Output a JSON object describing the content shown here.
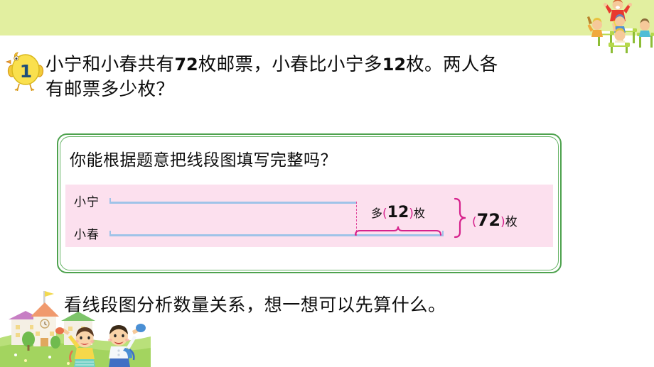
{
  "slide": {
    "band_color": "#e2efa0",
    "accent_green": "#4ea24e",
    "panel_pink": "#fce0ee",
    "segment_blue": "#9fc3e8",
    "annotation_magenta": "#d6228c",
    "badge_number": "1",
    "badge_number_color": "#1f4e79"
  },
  "problem": {
    "line1": "小宁和小春共有",
    "line1_number": "72",
    "line1_cont": "枚邮票，小春比小宁多",
    "line1_number2": "12",
    "line1_end": "枚。两人各",
    "line2": "有邮票多少枚？",
    "full_text": "小宁和小春共有72枚邮票，小春比小宁多12枚。两人各有邮票多少枚？"
  },
  "framed_box": {
    "question": "你能根据题意把线段图填写完整吗？"
  },
  "diagram": {
    "label_top": "小宁",
    "label_bottom": "小春",
    "difference_prefix": "多",
    "difference_open_paren": "(",
    "difference_value": "12",
    "difference_close_paren": ")",
    "difference_unit": "枚",
    "total_open_paren": "(",
    "total_value": "72",
    "total_close_paren": ")",
    "total_unit": "枚"
  },
  "bottom": {
    "prompt": "看线段图分析数量关系，想一想可以先算什么。"
  },
  "illustrations": {
    "top_right": "classroom-teacher-and-students-illustration",
    "bottom_left": "school-building-and-children-illustration"
  }
}
